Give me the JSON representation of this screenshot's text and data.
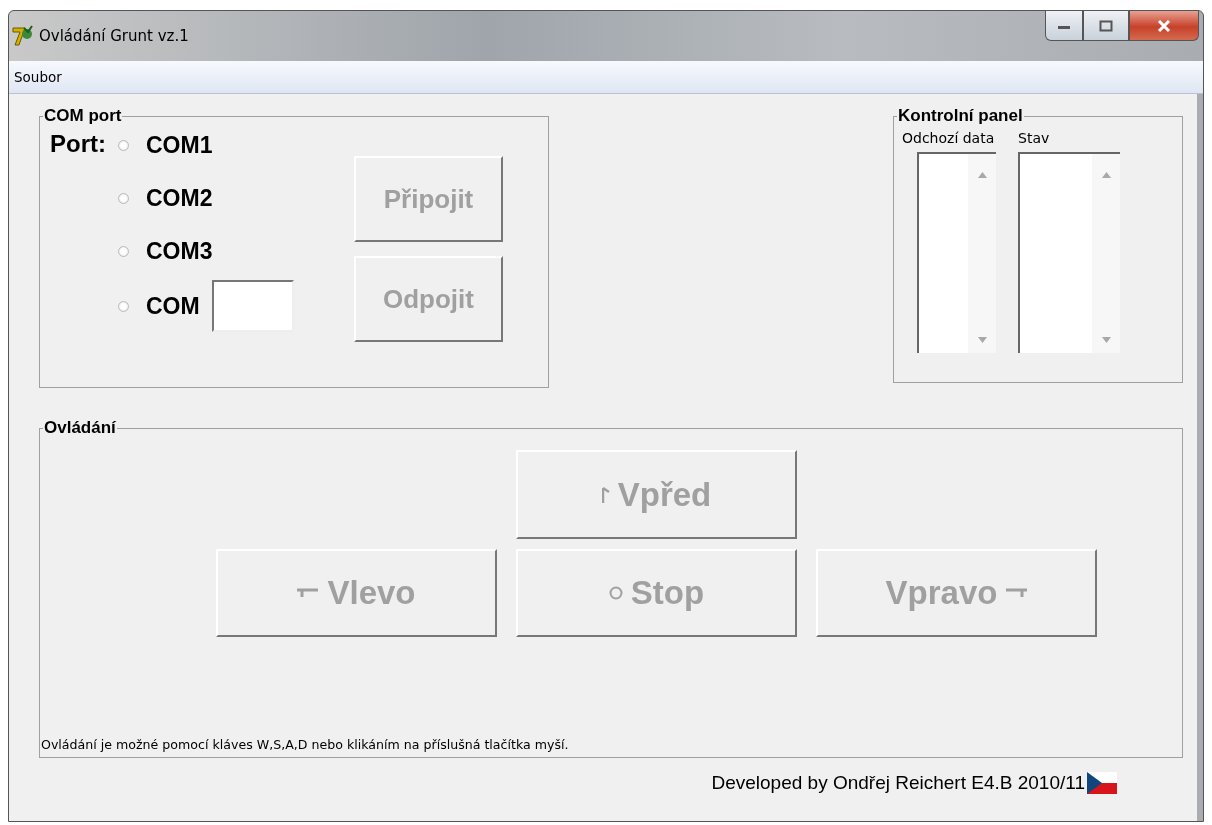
{
  "window": {
    "title": "Ovládání Grunt vz.1"
  },
  "menu": [
    {
      "label": "Soubor"
    }
  ],
  "com_port": {
    "title": "COM port",
    "port_label": "Port:",
    "options": [
      {
        "label": "COM1",
        "selected": false,
        "kind": "fixed"
      },
      {
        "label": "COM2",
        "selected": false,
        "kind": "fixed"
      },
      {
        "label": "COM3",
        "selected": false,
        "kind": "fixed"
      },
      {
        "label": "COM",
        "selected": false,
        "kind": "custom"
      }
    ],
    "buttons": [
      {
        "label": "Připojit",
        "disabled": true
      },
      {
        "label": "Odpojit",
        "disabled": true
      }
    ]
  },
  "control_panel": {
    "title": "Kontrolní panel",
    "lists": [
      {
        "label": "Odchozí data"
      },
      {
        "label": "Stav"
      }
    ]
  },
  "controls": {
    "title": "Ovládání",
    "buttons": [
      {
        "label": "Vpřed",
        "kind": "up",
        "disabled": true
      },
      {
        "label": "Vlevo",
        "kind": "left",
        "disabled": true
      },
      {
        "label": "Stop",
        "kind": "stop",
        "disabled": true
      },
      {
        "label": "Vpravo",
        "kind": "right",
        "disabled": true
      }
    ],
    "hint": "Ovládání je možné pomocí kláves W,S,A,D nebo klikáním na příslušná tlačítka myší."
  },
  "footer": "Developed by Ondřej Reichert E4.B 2010/11"
}
